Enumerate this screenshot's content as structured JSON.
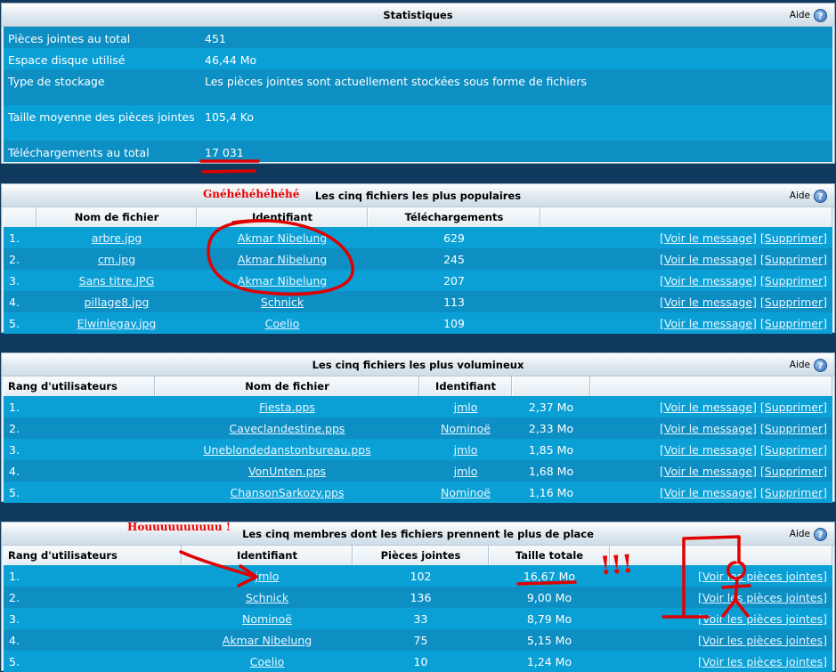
{
  "help_label": "Aide",
  "stats": {
    "title": "Statistiques",
    "rows": [
      {
        "label": "Pièces jointes au total",
        "value": "451"
      },
      {
        "label": "Espace disque utilisé",
        "value": "46,44 Mo"
      },
      {
        "label": "Type de stockage",
        "value": "Les pièces jointes sont actuellement stockées sous forme de fichiers"
      },
      {
        "label": "Taille moyenne des pièces jointes",
        "value": "105,4 Ko"
      },
      {
        "label": "Téléchargements au total",
        "value": "17 031"
      }
    ]
  },
  "popular": {
    "title": "Les cinq fichiers les plus populaires",
    "headers": [
      "Nom de fichier",
      "Identifiant",
      "Téléchargements"
    ],
    "rows": [
      {
        "rank": "1.",
        "file": "arbre.jpg",
        "user": "Akmar Nibelung",
        "count": "629"
      },
      {
        "rank": "2.",
        "file": "cm.jpg",
        "user": "Akmar Nibelung",
        "count": "245"
      },
      {
        "rank": "3.",
        "file": "Sans titre.JPG",
        "user": "Akmar Nibelung",
        "count": "207"
      },
      {
        "rank": "4.",
        "file": "pillage8.jpg",
        "user": "Schnick",
        "count": "113"
      },
      {
        "rank": "5.",
        "file": "Elwinlegay.jpg",
        "user": "Coelio",
        "count": "109"
      }
    ]
  },
  "largest": {
    "title": "Les cinq fichiers les plus volumineux",
    "headers": [
      "Rang d'utilisateurs",
      "Nom de fichier",
      "Identifiant",
      ""
    ],
    "rows": [
      {
        "rank": "1.",
        "file": "Fiesta.pps",
        "user": "jmlo",
        "size": "2,37 Mo"
      },
      {
        "rank": "2.",
        "file": "Caveclandestine.pps",
        "user": "Nominoë",
        "size": "2,33 Mo"
      },
      {
        "rank": "3.",
        "file": "Uneblondedanstonbureau.pps",
        "user": "jmlo",
        "size": "1,85 Mo"
      },
      {
        "rank": "4.",
        "file": "VonUnten.pps",
        "user": "jmlo",
        "size": "1,68 Mo"
      },
      {
        "rank": "5.",
        "file": "ChansonSarkozy.pps",
        "user": "Nominoë",
        "size": "1,16 Mo"
      }
    ]
  },
  "members": {
    "title": "Les cinq membres dont les fichiers prennent le plus de place",
    "headers": [
      "Rang d'utilisateurs",
      "Identifiant",
      "Pièces jointes",
      "Taille totale"
    ],
    "rows": [
      {
        "rank": "1.",
        "user": "jmlo",
        "count": "102",
        "size": "16,67 Mo"
      },
      {
        "rank": "2.",
        "user": "Schnick",
        "count": "136",
        "size": "9,00 Mo"
      },
      {
        "rank": "3.",
        "user": "Nominoë",
        "count": "33",
        "size": "8,79 Mo"
      },
      {
        "rank": "4.",
        "user": "Akmar Nibelung",
        "count": "75",
        "size": "5,15 Mo"
      },
      {
        "rank": "5.",
        "user": "Coelio",
        "count": "10",
        "size": "1,24 Mo"
      }
    ]
  },
  "actions": {
    "view_message": "[Voir le message]",
    "delete": "[Supprimer]",
    "view_attachments": "[Voir les pièces jointes]"
  },
  "annotations": {
    "scrawl_popular": "Gnéhéhéhéhéhé",
    "scrawl_members": "Houuuuuuuuuu !",
    "exclaim": "!!!",
    "color": "#e00000"
  }
}
